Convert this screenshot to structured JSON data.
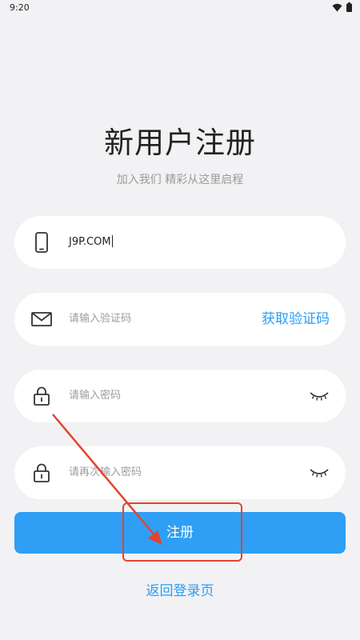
{
  "status_bar": {
    "time": "9:20",
    "icons": [
      "wifi-icon",
      "battery-icon"
    ]
  },
  "header": {
    "title": "新用户注册",
    "subtitle": "加入我们 精彩从这里启程"
  },
  "form": {
    "phone": {
      "value": "J9P.COM",
      "icon": "phone-icon"
    },
    "code": {
      "placeholder": "请输入验证码",
      "icon": "mail-icon",
      "get_code_label": "获取验证码"
    },
    "password": {
      "placeholder": "请输入密码",
      "icon": "lock-icon",
      "toggle_icon": "eye-closed-icon"
    },
    "confirm_password": {
      "placeholder": "请再次输入密码",
      "icon": "lock-icon",
      "toggle_icon": "eye-closed-icon"
    }
  },
  "register_button_label": "注册",
  "back_to_login_label": "返回登录页",
  "colors": {
    "accent": "#2e9ff5",
    "annotation": "#e2442f",
    "background": "#f2f2f4"
  }
}
